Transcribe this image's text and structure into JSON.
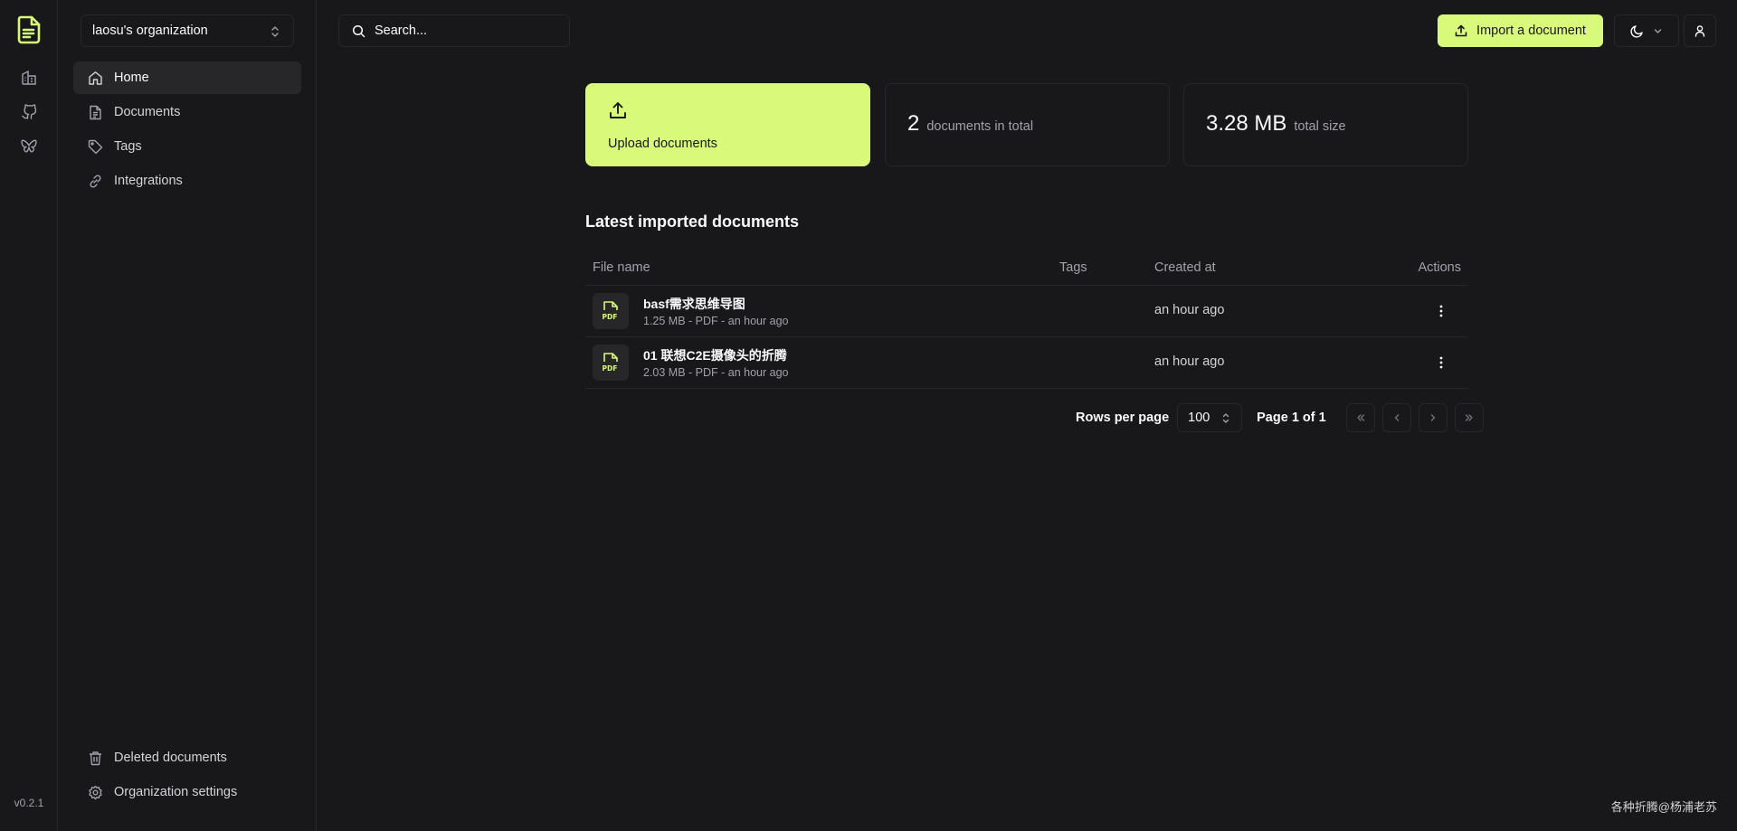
{
  "rail": {
    "version": "v0.2.1",
    "icons": [
      "papra-logo-icon",
      "building-icon",
      "github-icon",
      "butterfly-icon"
    ]
  },
  "sidebar": {
    "org_name": "laosu's organization",
    "items": [
      {
        "label": "Home",
        "icon": "home-icon",
        "active": true
      },
      {
        "label": "Documents",
        "icon": "document-icon",
        "active": false
      },
      {
        "label": "Tags",
        "icon": "tag-icon",
        "active": false
      },
      {
        "label": "Integrations",
        "icon": "link-icon",
        "active": false
      }
    ],
    "bottom_items": [
      {
        "label": "Deleted documents",
        "icon": "trash-icon"
      },
      {
        "label": "Organization settings",
        "icon": "gear-icon"
      }
    ]
  },
  "topbar": {
    "search_placeholder": "Search...",
    "import_label": "Import a document"
  },
  "cards": {
    "upload_label": "Upload documents",
    "doc_count": "2",
    "doc_count_label": "documents in total",
    "total_size": "3.28 MB",
    "total_size_label": "total size"
  },
  "latest": {
    "title": "Latest imported documents",
    "columns": {
      "file_name": "File name",
      "tags": "Tags",
      "created_at": "Created at",
      "actions": "Actions"
    },
    "rows": [
      {
        "name": "basf需求思维导图",
        "meta": "1.25 MB - PDF - an hour ago",
        "created": "an hour ago"
      },
      {
        "name": "01 联想C2E摄像头的折腾",
        "meta": "2.03 MB - PDF - an hour ago",
        "created": "an hour ago"
      }
    ]
  },
  "pagination": {
    "rows_per_page_label": "Rows per page",
    "rows_per_page": "100",
    "page_label": "Page 1 of 1"
  },
  "watermark": "各种折腾@杨浦老苏",
  "colors": {
    "accent": "#d9f97a",
    "background": "#18181b",
    "border": "#27272a"
  }
}
